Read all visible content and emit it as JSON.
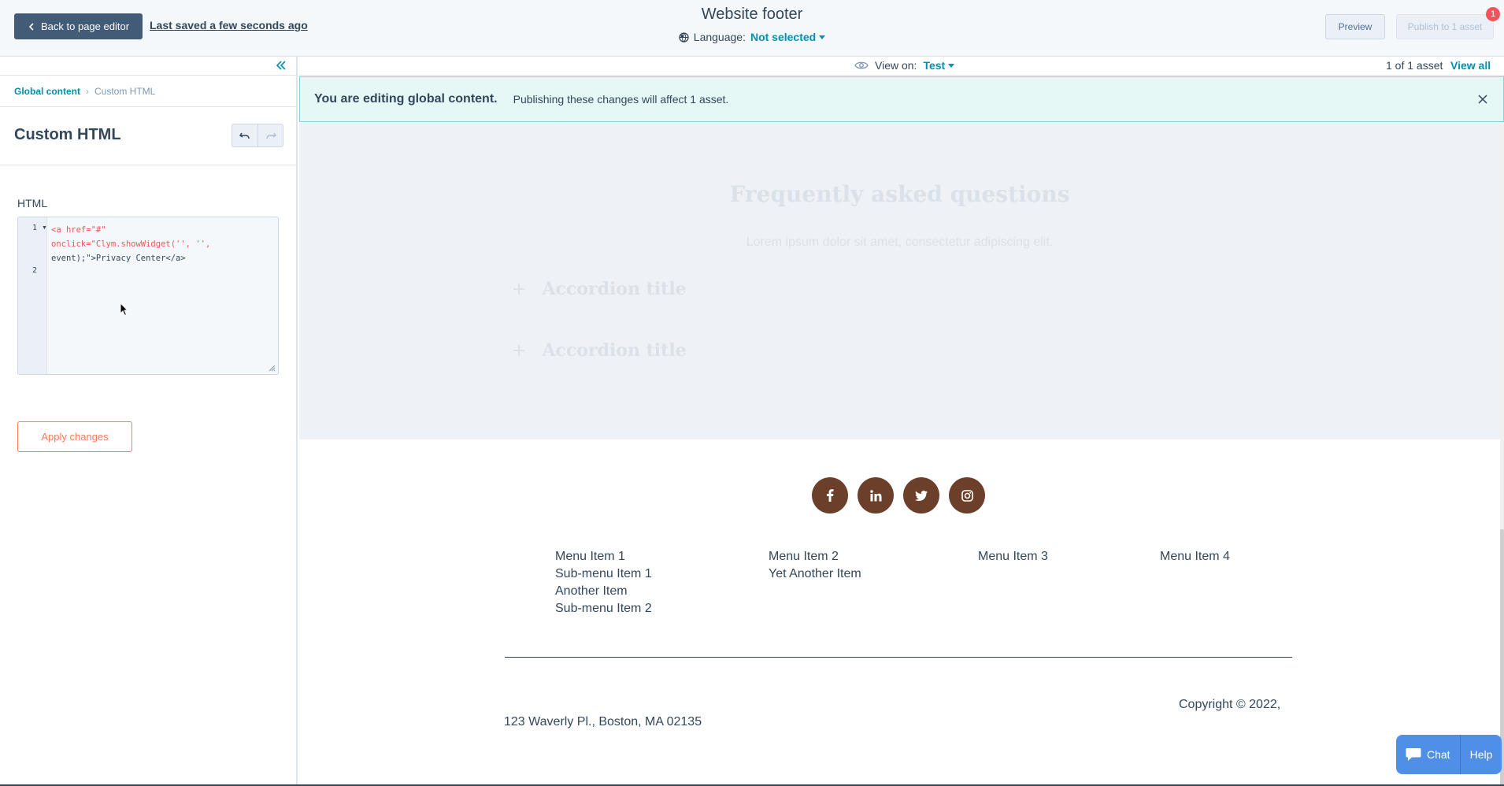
{
  "topbar": {
    "back_label": "Back to page editor",
    "saved_text": "Last saved a few seconds ago",
    "title": "Website footer",
    "language_label": "Language:",
    "language_value": "Not selected",
    "preview_label": "Preview",
    "publish_label": "Publish to 1 asset",
    "notification_count": "1"
  },
  "panel": {
    "breadcrumb_root": "Global content",
    "breadcrumb_current": "Custom HTML",
    "title": "Custom HTML",
    "field_label": "HTML",
    "code_lines": [
      "1",
      "2"
    ],
    "code_text_1a": "<a href=\"#\"",
    "code_text_1b": "onclick=\"Clym.showWidget('', '',",
    "code_text_1c": "event);\">Privacy Center</a>",
    "apply_label": "Apply changes"
  },
  "viewbar": {
    "view_on_label": "View on:",
    "view_on_value": "Test",
    "asset_count": "1 of 1 asset",
    "view_all": "View all"
  },
  "banner": {
    "bold_text": "You are editing global content.",
    "text": "Publishing these changes will affect 1 asset."
  },
  "faq": {
    "title": "Frequently asked questions",
    "subtitle": "Lorem ipsum dolor sit amet, consectetur adipiscing elit.",
    "accordions": [
      "Accordion title",
      "Accordion title"
    ]
  },
  "footer": {
    "social": [
      "facebook-icon",
      "linkedin-icon",
      "twitter-icon",
      "instagram-icon"
    ],
    "menu1": [
      "Menu Item 1",
      "Sub-menu Item 1",
      "Another Item",
      "Sub-menu Item 2"
    ],
    "menu2": [
      "Menu Item 2",
      "Yet Another Item"
    ],
    "menu3": [
      "Menu Item 3"
    ],
    "menu4": [
      "Menu Item 4"
    ],
    "copyright": "Copyright © 2022,",
    "address": "123 Waverly Pl., Boston, MA 02135"
  },
  "chat": {
    "chat_label": "Chat",
    "help_label": "Help"
  },
  "colors": {
    "accent": "#0091ae",
    "primary_button": "#425b76",
    "apply_border": "#ff7a59",
    "social_bg": "#6b3f2a",
    "banner_bg": "#e5f8f6"
  }
}
